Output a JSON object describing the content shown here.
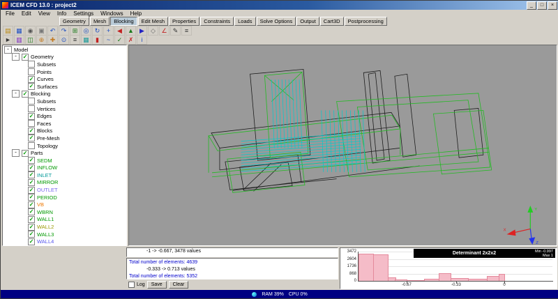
{
  "window": {
    "title": "ICEM CFD 13.0 : project2",
    "buttons": {
      "minimize": "_",
      "maximize": "□",
      "close": "×"
    }
  },
  "menubar": {
    "items": [
      "File",
      "Edit",
      "View",
      "Info",
      "Settings",
      "Windows",
      "Help"
    ]
  },
  "tabbar": {
    "selected": "Blocking",
    "items": [
      "Geometry",
      "Mesh",
      "Blocking",
      "Edit Mesh",
      "Properties",
      "Constraints",
      "Loads",
      "Solve Options",
      "Output",
      "Cart3D",
      "Postprocessing"
    ]
  },
  "toolbars": {
    "row1": [
      {
        "name": "open-project-icon",
        "glyph": "▤",
        "color": "#b8860b"
      },
      {
        "name": "save-project-icon",
        "glyph": "▦",
        "color": "#1e4fc2"
      },
      {
        "name": "screenshot-icon",
        "glyph": "◉",
        "color": "#555555"
      },
      {
        "name": "print-icon",
        "glyph": "▣",
        "color": "#777777"
      },
      {
        "name": "undo-icon",
        "glyph": "↶",
        "color": "#1e4fc2"
      },
      {
        "name": "redo-icon",
        "glyph": "↷",
        "color": "#1e4fc2"
      },
      {
        "name": "fit-window-icon",
        "glyph": "⊞",
        "color": "#1b7a1b"
      },
      {
        "name": "zoom-window-icon",
        "glyph": "◎",
        "color": "#1e4fc2"
      },
      {
        "name": "rotate-view-icon",
        "glyph": "↻",
        "color": "#1e4fc2"
      },
      {
        "name": "pan-view-icon",
        "glyph": "+",
        "color": "#1e4fc2"
      },
      {
        "name": "view-x-icon",
        "glyph": "◀",
        "color": "#c22222"
      },
      {
        "name": "view-y-icon",
        "glyph": "▲",
        "color": "#1b7a1b"
      },
      {
        "name": "view-z-icon",
        "glyph": "▶",
        "color": "#2222c2"
      },
      {
        "name": "view-iso-icon",
        "glyph": "◇",
        "color": "#666666"
      },
      {
        "name": "measure-icon",
        "glyph": "∠",
        "color": "#c22222"
      },
      {
        "name": "annotation-icon",
        "glyph": "✎",
        "color": "#333333"
      },
      {
        "name": "display-options-icon",
        "glyph": "≡",
        "color": "#333333"
      }
    ],
    "row2": [
      {
        "name": "select-icon",
        "glyph": "►",
        "color": "#333333"
      },
      {
        "name": "split-block-icon",
        "glyph": "▥",
        "color": "#7a22c2"
      },
      {
        "name": "ogrid-block-icon",
        "glyph": "◫",
        "color": "#1b7a1b"
      },
      {
        "name": "merge-vertices-icon",
        "glyph": "⊕",
        "color": "#c27a22"
      },
      {
        "name": "move-vertex-icon",
        "glyph": "✚",
        "color": "#c27a22"
      },
      {
        "name": "associate-icon",
        "glyph": "⊙",
        "color": "#1e4fc2"
      },
      {
        "name": "edge-params-icon",
        "glyph": "≡",
        "color": "#333333"
      },
      {
        "name": "premesh-params-icon",
        "glyph": "▦",
        "color": "#1b9a9a"
      },
      {
        "name": "quality-histogram-icon",
        "glyph": "▮",
        "color": "#c22222"
      },
      {
        "name": "smooth-mesh-icon",
        "glyph": "~",
        "color": "#1e4fc2"
      },
      {
        "name": "check-mesh-icon",
        "glyph": "✓",
        "color": "#1b7a1b"
      },
      {
        "name": "delete-block-icon",
        "glyph": "✗",
        "color": "#c22222"
      },
      {
        "name": "info-icon",
        "glyph": "i",
        "color": "#1e4fc2"
      }
    ]
  },
  "tree": {
    "rows": [
      {
        "id": "model",
        "label": "Model",
        "depth": 0,
        "expander": true,
        "checkbox": false
      },
      {
        "id": "geometry",
        "label": "Geometry",
        "depth": 1,
        "expander": true,
        "checkbox": true,
        "checked": true
      },
      {
        "id": "geometry-subsets",
        "label": "Subsets",
        "depth": 2,
        "checkbox": true,
        "checked": false
      },
      {
        "id": "points",
        "label": "Points",
        "depth": 2,
        "checkbox": true,
        "checked": false
      },
      {
        "id": "curves",
        "label": "Curves",
        "depth": 2,
        "checkbox": true,
        "checked": true
      },
      {
        "id": "surfaces",
        "label": "Surfaces",
        "depth": 2,
        "checkbox": true,
        "checked": true
      },
      {
        "id": "blocking",
        "label": "Blocking",
        "depth": 1,
        "expander": true,
        "checkbox": true,
        "checked": true
      },
      {
        "id": "blocking-subsets",
        "label": "Subsets",
        "depth": 2,
        "checkbox": true,
        "checked": false
      },
      {
        "id": "vertices",
        "label": "Vertices",
        "depth": 2,
        "checkbox": true,
        "checked": false
      },
      {
        "id": "edges",
        "label": "Edges",
        "depth": 2,
        "checkbox": true,
        "checked": true
      },
      {
        "id": "faces",
        "label": "Faces",
        "depth": 2,
        "checkbox": true,
        "checked": false
      },
      {
        "id": "blocks",
        "label": "Blocks",
        "depth": 2,
        "checkbox": true,
        "checked": true
      },
      {
        "id": "pre-mesh",
        "label": "Pre-Mesh",
        "depth": 2,
        "checkbox": true,
        "checked": true
      },
      {
        "id": "topology",
        "label": "Topology",
        "depth": 2,
        "checkbox": true,
        "checked": false
      },
      {
        "id": "parts",
        "label": "Parts",
        "depth": 1,
        "expander": true,
        "checkbox": true,
        "checked": true
      },
      {
        "id": "part-sedm",
        "label": "SEDM",
        "depth": 2,
        "checkbox": true,
        "checked": true,
        "color": "#009900"
      },
      {
        "id": "part-inflow",
        "label": "INFLOW",
        "depth": 2,
        "checkbox": true,
        "checked": true,
        "color": "#009900"
      },
      {
        "id": "part-inlet",
        "label": "INLET",
        "depth": 2,
        "checkbox": true,
        "checked": true,
        "color": "#009999"
      },
      {
        "id": "part-mirror",
        "label": "MIRROR",
        "depth": 2,
        "checkbox": true,
        "checked": true,
        "color": "#009900"
      },
      {
        "id": "part-outlet",
        "label": "OUTLET",
        "depth": 2,
        "checkbox": true,
        "checked": true,
        "color": "#7766ee"
      },
      {
        "id": "part-period",
        "label": "PERIOD",
        "depth": 2,
        "checkbox": true,
        "checked": true,
        "color": "#009900"
      },
      {
        "id": "part-vb",
        "label": "VB",
        "depth": 2,
        "checkbox": true,
        "checked": true,
        "color": "#ee7700"
      },
      {
        "id": "part-wbrn",
        "label": "WBRN",
        "depth": 2,
        "checkbox": true,
        "checked": true,
        "color": "#009900"
      },
      {
        "id": "part-wall1",
        "label": "WALL1",
        "depth": 2,
        "checkbox": true,
        "checked": true,
        "color": "#009900"
      },
      {
        "id": "part-wall2",
        "label": "WALL2",
        "depth": 2,
        "checkbox": true,
        "checked": true,
        "color": "#999900"
      },
      {
        "id": "part-wall3",
        "label": "WALL3",
        "depth": 2,
        "checkbox": true,
        "checked": true,
        "color": "#009900"
      },
      {
        "id": "part-wall4",
        "label": "WALL4",
        "depth": 2,
        "checkbox": true,
        "checked": true,
        "color": "#5555ee"
      }
    ]
  },
  "viewport": {
    "background": "#9a9a9a",
    "colors": {
      "geometry_lines": "#1c1c1c",
      "blocking_lines": "#22bb22",
      "edge_lines": "#00cccc"
    },
    "axis_labels": {
      "x": "X",
      "y": "Y",
      "z": "Z"
    }
  },
  "message_panel": {
    "readout": "-1 -> -0.667, 3478 values",
    "log_lines": [
      {
        "text": "Total number of elements: 4639",
        "color": "#0000cc"
      },
      {
        "text": "-0.333 -> 0.713 values",
        "color": "#000000",
        "indent": true
      },
      {
        "text": "Total number of elements: 5352",
        "color": "#0000cc"
      }
    ],
    "log_checkbox_label": "Log",
    "save_button": "Save",
    "clear_button": "Clear"
  },
  "chart_data": {
    "type": "bar",
    "title": "Determinant 2x2x2",
    "legend": [
      "Min -0.997",
      "Max 1"
    ],
    "x_range": [
      -1,
      0.33
    ],
    "x_ticks": [
      -0.67,
      -0.33,
      0
    ],
    "y_range": [
      0,
      3472
    ],
    "y_ticks": [
      0,
      868,
      1736,
      2604,
      3472
    ],
    "bar_color": "#f5bcc8",
    "bar_border_color": "#e4899b",
    "bars": [
      {
        "from": -1.0,
        "to": -0.9,
        "count": 3250
      },
      {
        "from": -0.9,
        "to": -0.8,
        "count": 3150
      },
      {
        "from": -0.8,
        "to": -0.75,
        "count": 420
      },
      {
        "from": -0.75,
        "to": -0.67,
        "count": 180
      },
      {
        "from": -0.67,
        "to": -0.55,
        "count": 120
      },
      {
        "from": -0.55,
        "to": -0.45,
        "count": 260
      },
      {
        "from": -0.45,
        "to": -0.37,
        "count": 870
      },
      {
        "from": -0.37,
        "to": -0.25,
        "count": 340
      },
      {
        "from": -0.25,
        "to": -0.12,
        "count": 280
      },
      {
        "from": -0.12,
        "to": -0.04,
        "count": 620
      },
      {
        "from": -0.04,
        "to": 0.0,
        "count": 840
      }
    ]
  },
  "statusbar": {
    "ram": "RAM 39%",
    "cpu": "CPU 0%"
  }
}
